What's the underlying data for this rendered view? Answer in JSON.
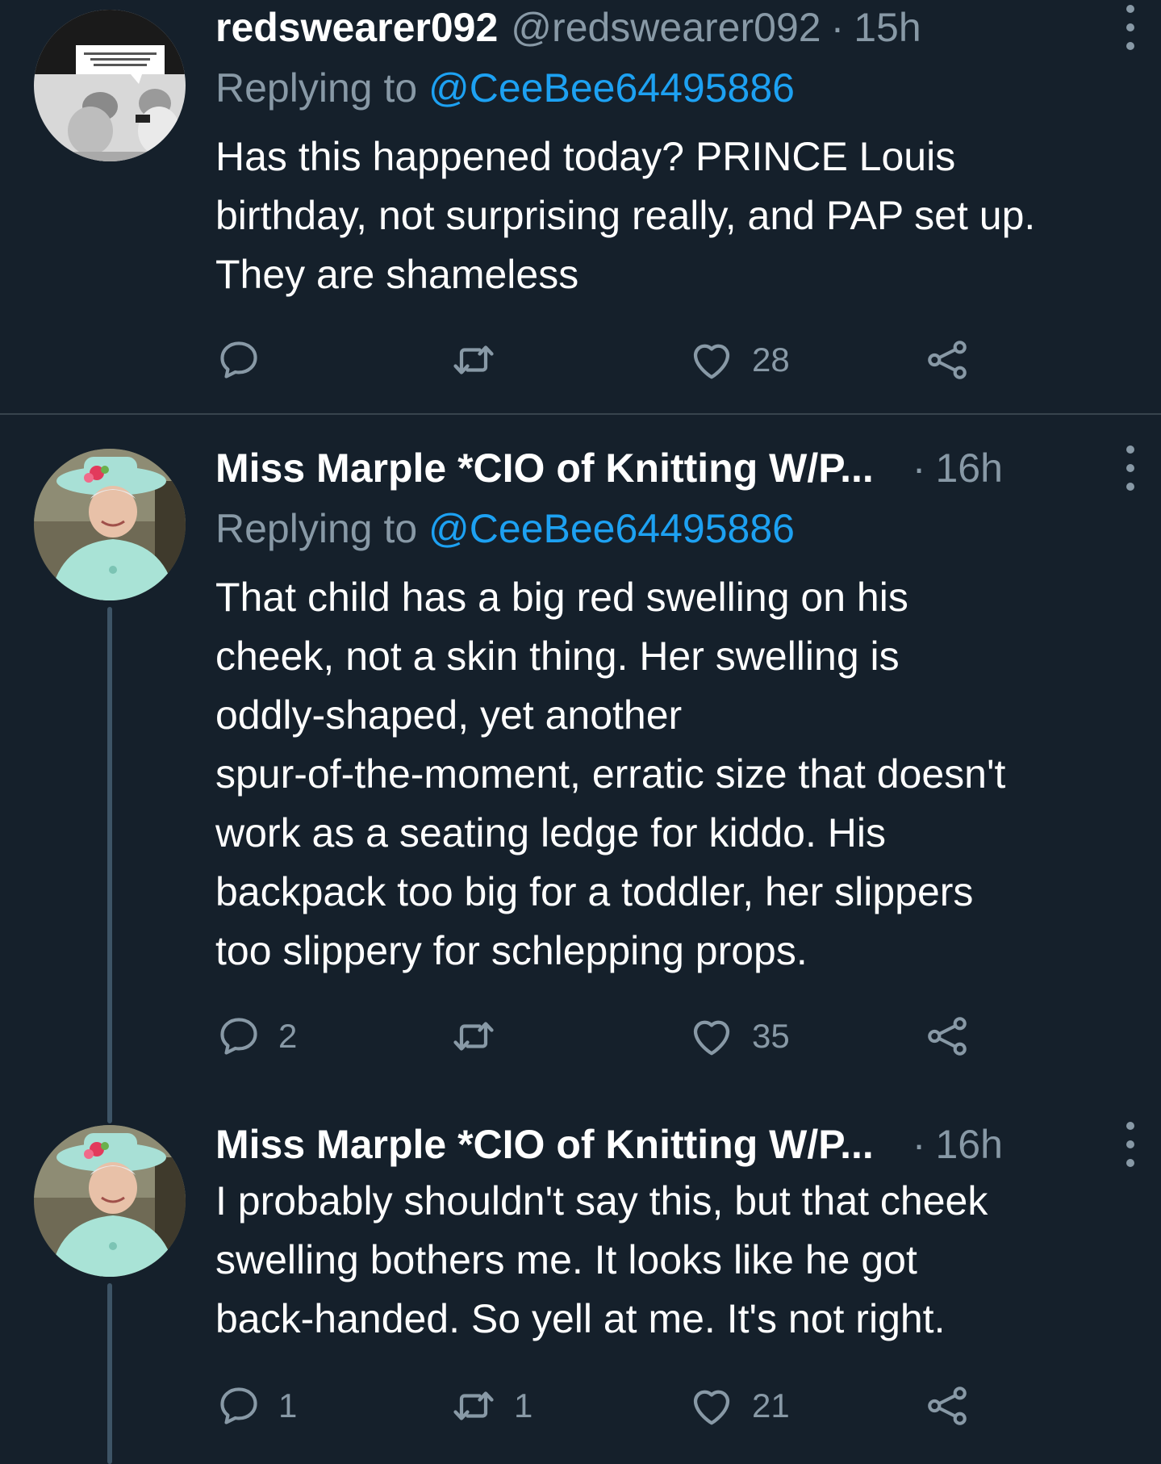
{
  "colors": {
    "background": "#15202b",
    "primary_text": "#ffffff",
    "secondary_text": "#8899a6",
    "link": "#1da1f2",
    "divider": "#38444d",
    "thread_line": "#3d5466"
  },
  "icons": {
    "reply": "speech-bubble-icon",
    "retweet": "retweet-arrows-icon",
    "like": "heart-icon",
    "share": "share-nodes-icon",
    "more": "vertical-ellipsis-icon"
  },
  "tweets": [
    {
      "display_name": "redswearer092",
      "handle": "@redswearer092",
      "time_sep": "·",
      "time": "15h",
      "replying_prefix": "Replying to ",
      "replying_to": "@CeeBee64495886",
      "text": "Has this happened today? PRINCE Louis\nbirthday, not surprising really, and PAP set up.\nThey are shameless",
      "reply_count": "",
      "retweet_count": "",
      "like_count": "28"
    },
    {
      "display_name": "Miss Marple *CIO of Knitting W/P...",
      "handle": "",
      "time_sep": "·",
      "time": "16h",
      "replying_prefix": "Replying to ",
      "replying_to": "@CeeBee64495886",
      "text": "That child has a big red swelling on his\ncheek, not a skin thing. Her swelling is\noddly-shaped, yet another\nspur-of-the-moment, erratic size that doesn't\nwork as a seating ledge for kiddo. His\nbackpack too big for a toddler, her slippers\ntoo slippery for schlepping props.",
      "reply_count": "2",
      "retweet_count": "",
      "like_count": "35"
    },
    {
      "display_name": "Miss Marple *CIO of Knitting W/P...",
      "handle": "",
      "time_sep": "·",
      "time": "16h",
      "text": "I probably shouldn't say this, but that cheek\nswelling bothers me. It looks like he got\nback-handed. So yell at me. It's not right.",
      "reply_count": "1",
      "retweet_count": "1",
      "like_count": "21"
    }
  ]
}
